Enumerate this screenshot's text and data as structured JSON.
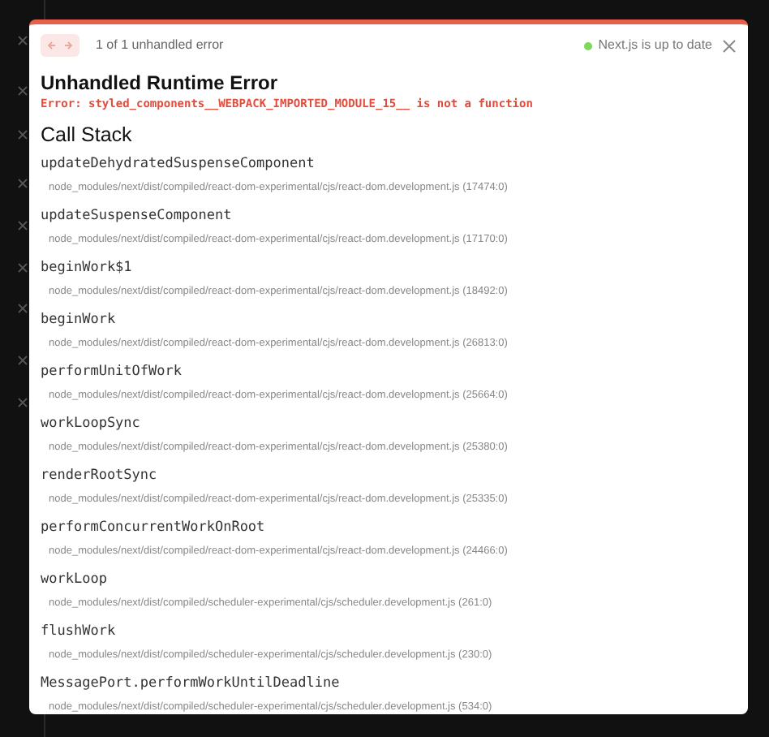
{
  "header": {
    "counter": "1 of 1 unhandled error",
    "status": "Next.js is up to date"
  },
  "title": "Unhandled Runtime Error",
  "error": "Error: styled_components__WEBPACK_IMPORTED_MODULE_15__ is not a function",
  "section_title": "Call Stack",
  "frames": [
    {
      "name": "updateDehydratedSuspenseComponent",
      "location": "node_modules/next/dist/compiled/react-dom-experimental/cjs/react-dom.development.js (17474:0)"
    },
    {
      "name": "updateSuspenseComponent",
      "location": "node_modules/next/dist/compiled/react-dom-experimental/cjs/react-dom.development.js (17170:0)"
    },
    {
      "name": "beginWork$1",
      "location": "node_modules/next/dist/compiled/react-dom-experimental/cjs/react-dom.development.js (18492:0)"
    },
    {
      "name": "beginWork",
      "location": "node_modules/next/dist/compiled/react-dom-experimental/cjs/react-dom.development.js (26813:0)"
    },
    {
      "name": "performUnitOfWork",
      "location": "node_modules/next/dist/compiled/react-dom-experimental/cjs/react-dom.development.js (25664:0)"
    },
    {
      "name": "workLoopSync",
      "location": "node_modules/next/dist/compiled/react-dom-experimental/cjs/react-dom.development.js (25380:0)"
    },
    {
      "name": "renderRootSync",
      "location": "node_modules/next/dist/compiled/react-dom-experimental/cjs/react-dom.development.js (25335:0)"
    },
    {
      "name": "performConcurrentWorkOnRoot",
      "location": "node_modules/next/dist/compiled/react-dom-experimental/cjs/react-dom.development.js (24466:0)"
    },
    {
      "name": "workLoop",
      "location": "node_modules/next/dist/compiled/scheduler-experimental/cjs/scheduler.development.js (261:0)"
    },
    {
      "name": "flushWork",
      "location": "node_modules/next/dist/compiled/scheduler-experimental/cjs/scheduler.development.js (230:0)"
    },
    {
      "name": "MessagePort.performWorkUntilDeadline",
      "location": "node_modules/next/dist/compiled/scheduler-experimental/cjs/scheduler.development.js (534:0)"
    }
  ]
}
